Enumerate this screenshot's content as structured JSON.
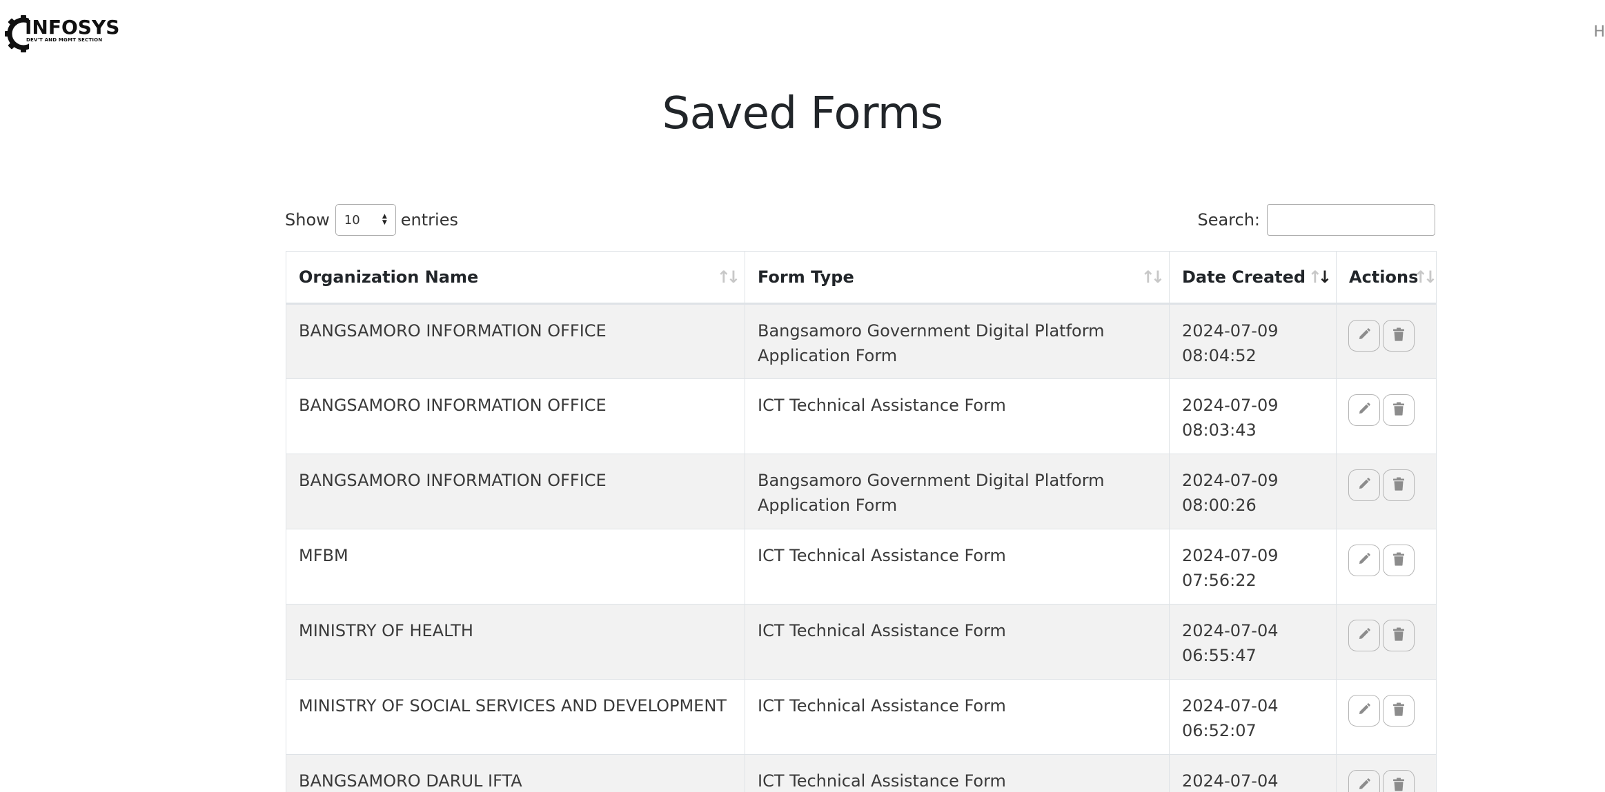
{
  "header": {
    "logo_name": "INFOSYS",
    "logo_subtitle": "DEV'T AND MGMT SECTION",
    "corner_text": "H"
  },
  "page_title": "Saved Forms",
  "controls": {
    "show_label": "Show",
    "entries_value": "10",
    "entries_label": "entries",
    "search_label": "Search:",
    "search_value": ""
  },
  "table": {
    "columns": [
      "Organization Name",
      "Form Type",
      "Date Created",
      "Actions"
    ],
    "rows": [
      {
        "org": "BANGSAMORO INFORMATION OFFICE",
        "form": "Bangsamoro Government Digital Platform Application Form",
        "date": "2024-07-09",
        "time": "08:04:52"
      },
      {
        "org": "BANGSAMORO INFORMATION OFFICE",
        "form": "ICT Technical Assistance Form",
        "date": "2024-07-09",
        "time": "08:03:43"
      },
      {
        "org": "BANGSAMORO INFORMATION OFFICE",
        "form": "Bangsamoro Government Digital Platform Application Form",
        "date": "2024-07-09",
        "time": "08:00:26"
      },
      {
        "org": "MFBM",
        "form": "ICT Technical Assistance Form",
        "date": "2024-07-09",
        "time": "07:56:22"
      },
      {
        "org": "MINISTRY OF HEALTH",
        "form": "ICT Technical Assistance Form",
        "date": "2024-07-04",
        "time": "06:55:47"
      },
      {
        "org": "MINISTRY OF SOCIAL SERVICES AND DEVELOPMENT",
        "form": "ICT Technical Assistance Form",
        "date": "2024-07-04",
        "time": "06:52:07"
      },
      {
        "org": "BANGSAMORO DARUL IFTA",
        "form": "ICT Technical Assistance Form",
        "date": "2024-07-04",
        "time": ""
      }
    ]
  },
  "icons": {
    "edit": "pencil-icon",
    "delete": "trash-icon",
    "sort": "sort-arrows-icon"
  }
}
